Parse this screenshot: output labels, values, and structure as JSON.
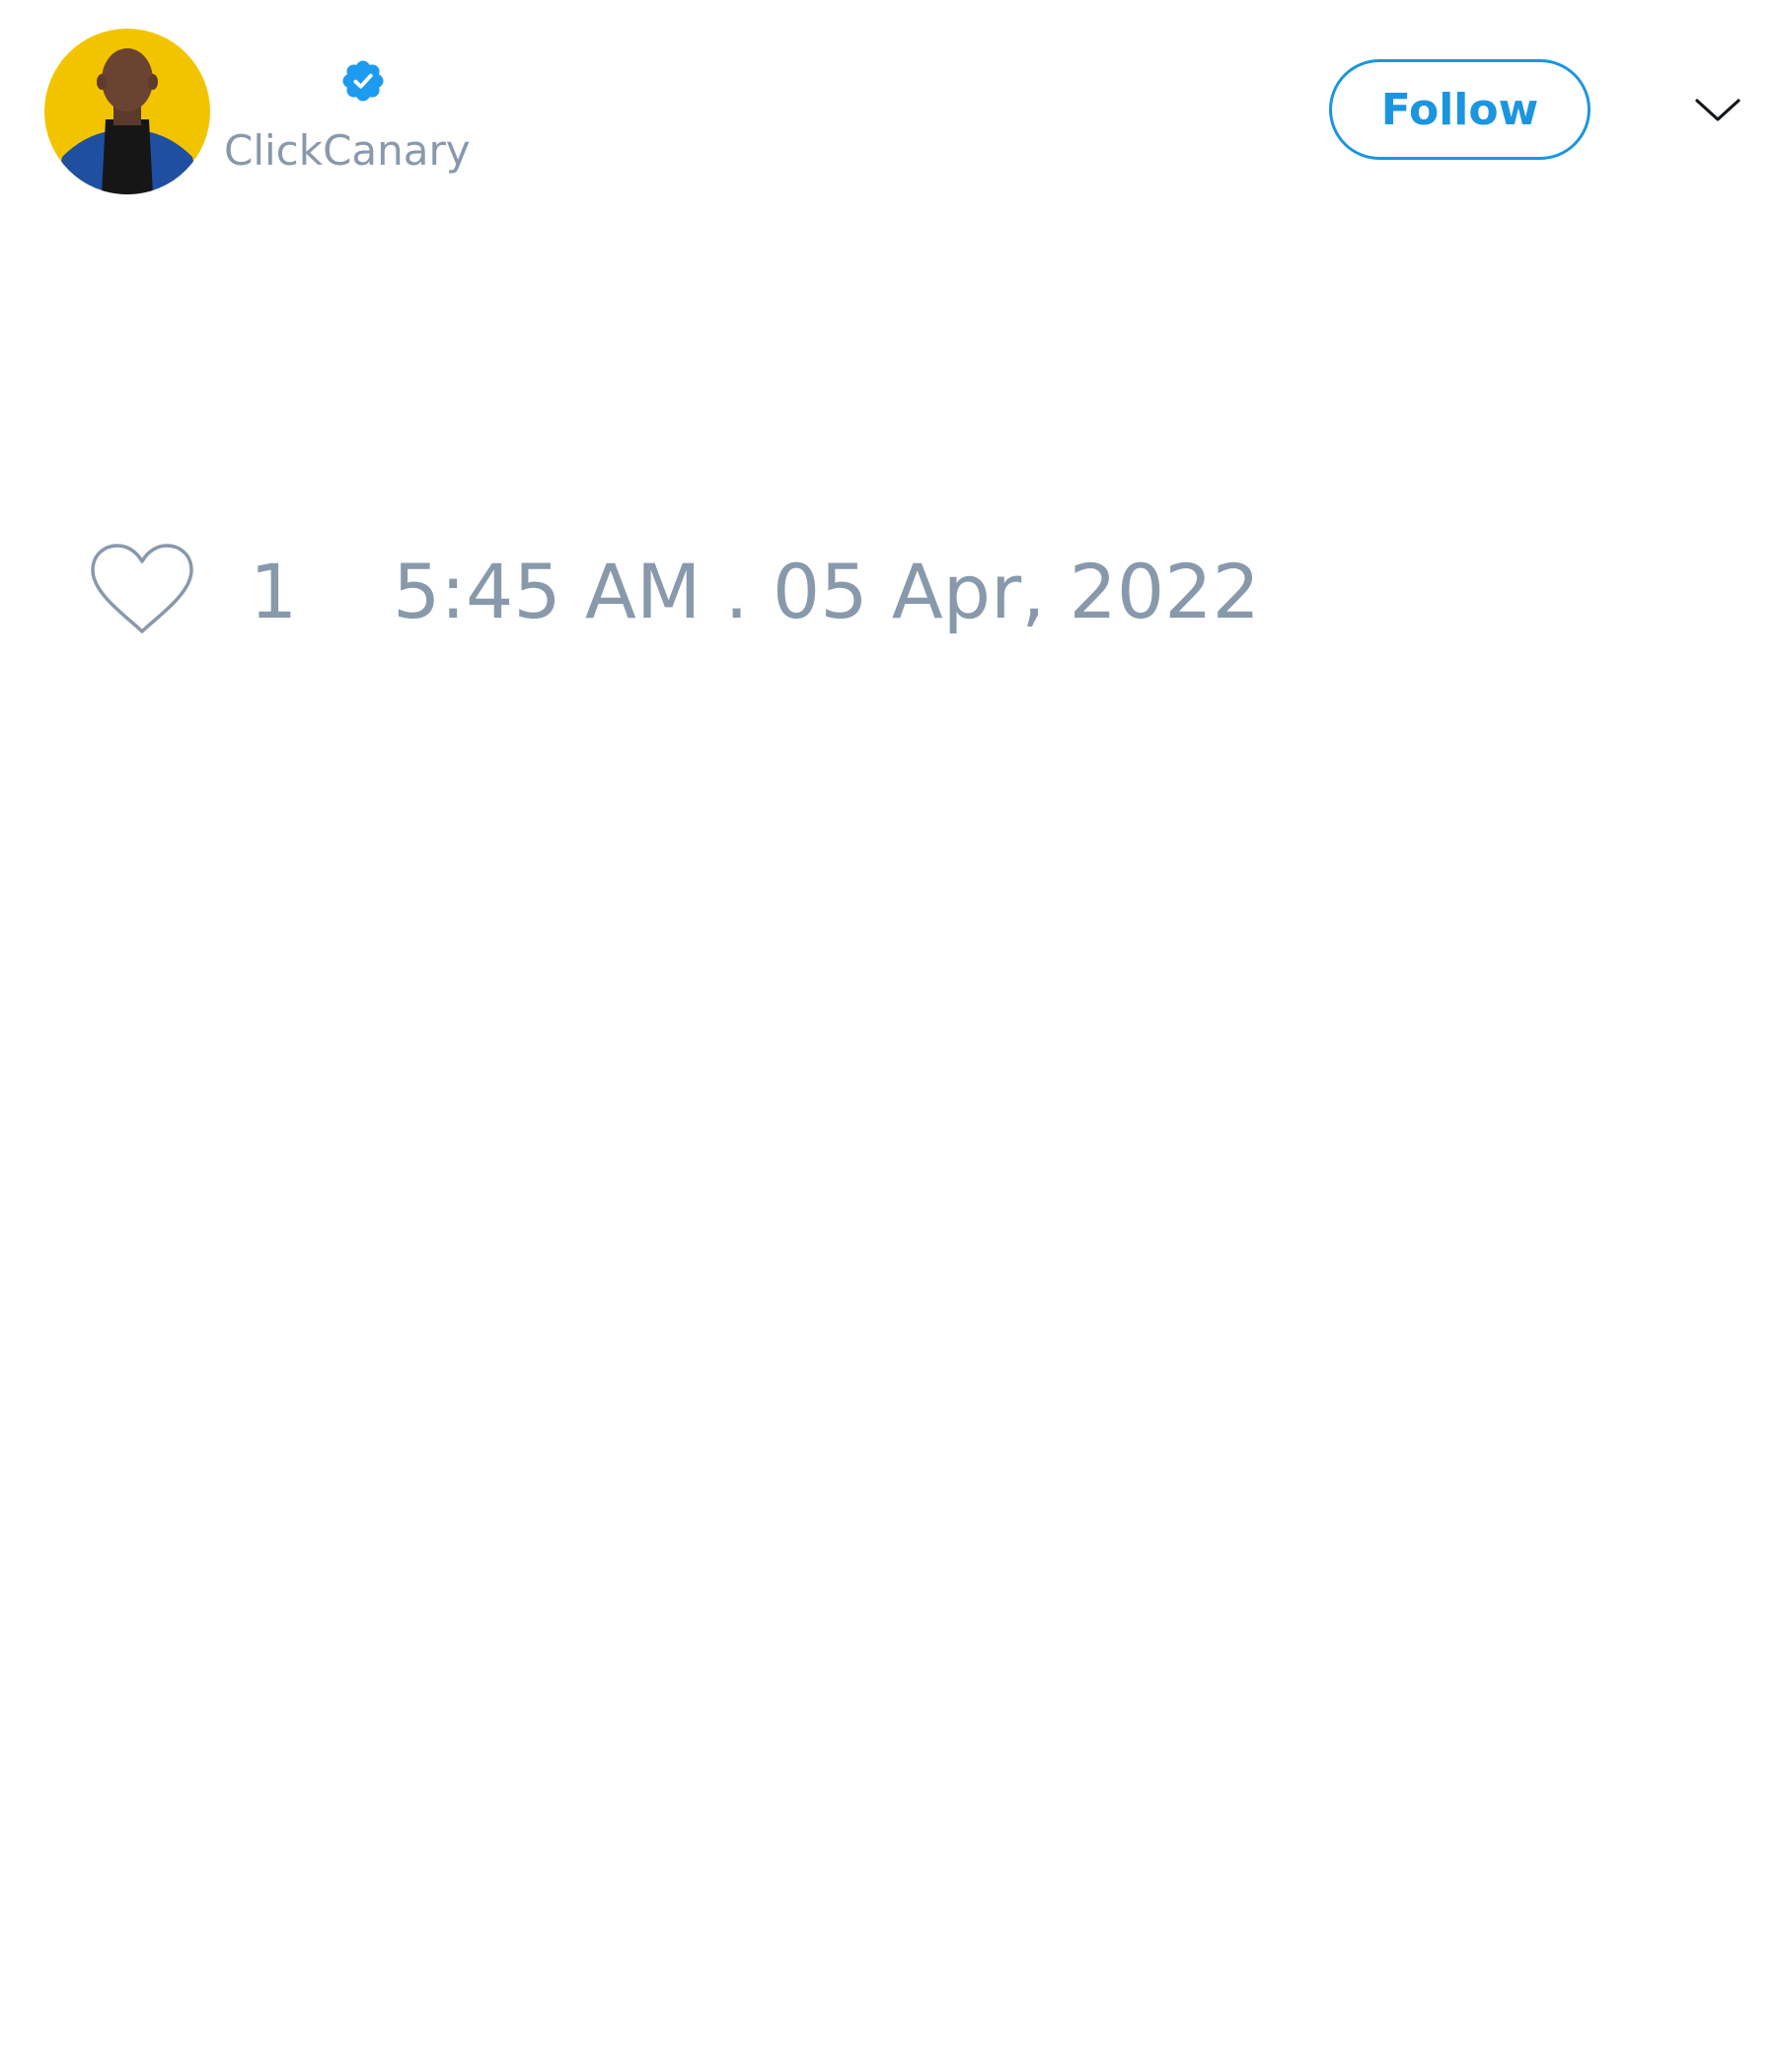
{
  "tweet": {
    "author": {
      "handle": "ClickCanary",
      "verified": true,
      "avatar_icon": "profile-photo"
    },
    "actions": {
      "follow_label": "Follow",
      "menu_icon": "chevron-down-icon"
    },
    "footer": {
      "like_icon": "heart-outline-icon",
      "like_count": "1",
      "timestamp": "5:45 AM . 05 Apr, 2022"
    }
  },
  "colors": {
    "accent": "#1b95e0",
    "verified": "#1d9bf0",
    "muted_text": "#8899ac",
    "icon_stroke": "#8899ac",
    "avatar_background": "#f2c400"
  }
}
